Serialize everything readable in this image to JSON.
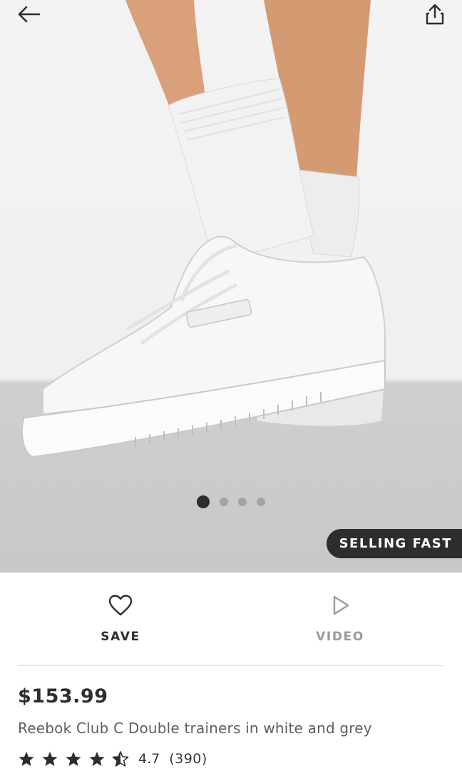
{
  "nav": {
    "back_icon": "arrow-left-icon",
    "share_icon": "share-icon"
  },
  "gallery": {
    "slide_count": 4,
    "active_index": 0,
    "badge": "SELLING FAST"
  },
  "actions": {
    "save_label": "SAVE",
    "save_icon": "heart-icon",
    "video_label": "VIDEO",
    "video_icon": "play-icon"
  },
  "product": {
    "price": "$153.99",
    "title": "Reebok Club C Double trainers in white and grey",
    "rating": {
      "score": "4.7",
      "count": "(390)",
      "stars_value": 4.5,
      "stars_max": 5
    }
  },
  "colors": {
    "text": "#2d2d2d",
    "muted": "#9b9b9b",
    "badge_bg": "#2d2d2d",
    "badge_text": "#ffffff"
  }
}
